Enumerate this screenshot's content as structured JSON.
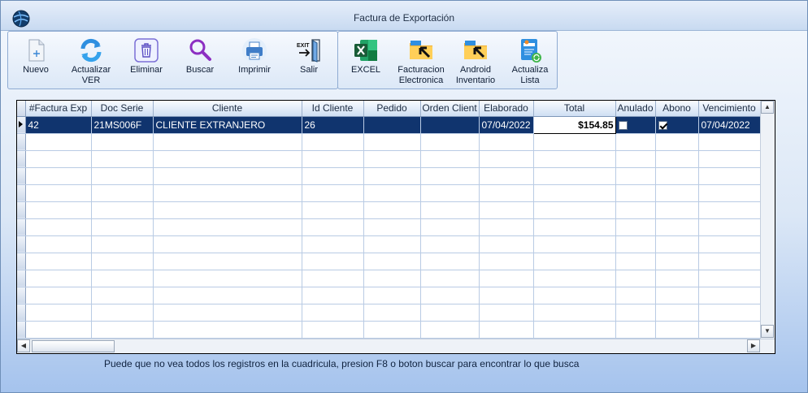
{
  "window": {
    "title": "Factura de Exportación"
  },
  "toolbar": {
    "nuevo": "Nuevo",
    "actualizar": [
      "Actualizar",
      "VER"
    ],
    "eliminar": "Eliminar",
    "buscar": "Buscar",
    "imprimir": "Imprimir",
    "salir": "Salir",
    "exit_text": "EXIT",
    "excel": "EXCEL",
    "facturacion": [
      "Facturacion",
      "Electronica"
    ],
    "android": [
      "Android",
      "Inventario"
    ],
    "actualiza": [
      "Actualiza",
      "Lista"
    ]
  },
  "grid": {
    "columns": [
      "#Factura Exp",
      "Doc Serie",
      "Cliente",
      "Id Cliente",
      "Pedido",
      "Orden Client",
      "Elaborado",
      "Total",
      "Anulado",
      "Abono",
      "Vencimiento"
    ],
    "rows": [
      {
        "factura": "42",
        "serie": "21MS006F",
        "cliente": "CLIENTE EXTRANJERO",
        "id_cliente": "26",
        "pedido": "",
        "orden": "",
        "elaborado": "07/04/2022",
        "total": "$154.85",
        "anulado": false,
        "abono": true,
        "vencimiento": "07/04/2022"
      }
    ]
  },
  "status": {
    "text": "Puede que no vea todos los registros en la cuadricula, presion F8 o boton buscar para encontrar lo que busca"
  },
  "colors": {
    "selection": "#10346e",
    "excel_green": "#1d7a43",
    "accent_blue": "#2f7fd8"
  }
}
